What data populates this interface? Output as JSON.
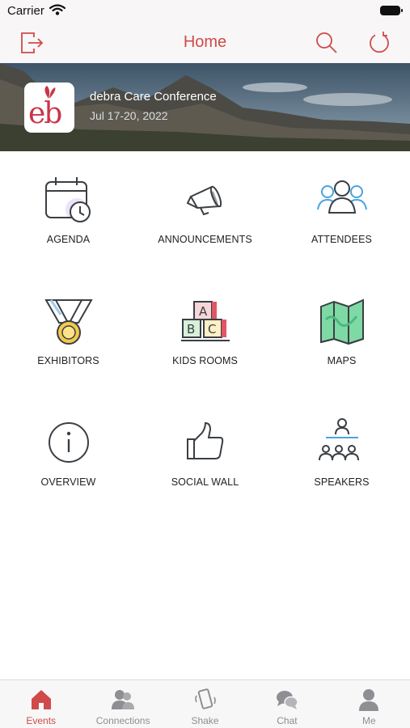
{
  "status_bar": {
    "carrier": "Carrier"
  },
  "nav": {
    "title": "Home"
  },
  "event": {
    "name": "debra Care Conference",
    "date": "Jul 17-20, 2022",
    "logo_text": "eb"
  },
  "tiles": [
    {
      "label": "AGENDA",
      "icon": "calendar-clock-icon"
    },
    {
      "label": "ANNOUNCEMENTS",
      "icon": "megaphone-icon"
    },
    {
      "label": "ATTENDEES",
      "icon": "people-icon"
    },
    {
      "label": "EXHIBITORS",
      "icon": "medal-icon"
    },
    {
      "label": "KIDS ROOMS",
      "icon": "abc-blocks-icon"
    },
    {
      "label": "MAPS",
      "icon": "map-icon"
    },
    {
      "label": "OVERVIEW",
      "icon": "info-icon"
    },
    {
      "label": "SOCIAL WALL",
      "icon": "thumbs-up-icon"
    },
    {
      "label": "SPEAKERS",
      "icon": "speaker-audience-icon"
    }
  ],
  "tabs": [
    {
      "label": "Events",
      "icon": "house-icon",
      "active": true
    },
    {
      "label": "Connections",
      "icon": "connections-icon",
      "active": false
    },
    {
      "label": "Shake",
      "icon": "shake-phone-icon",
      "active": false
    },
    {
      "label": "Chat",
      "icon": "chat-bubbles-icon",
      "active": false
    },
    {
      "label": "Me",
      "icon": "person-icon",
      "active": false
    }
  ],
  "colors": {
    "accent": "#d04a4a",
    "inactive_tab": "#8e8e93",
    "icon_stroke": "#3a3f44",
    "icon_blue": "#4aa3df"
  }
}
